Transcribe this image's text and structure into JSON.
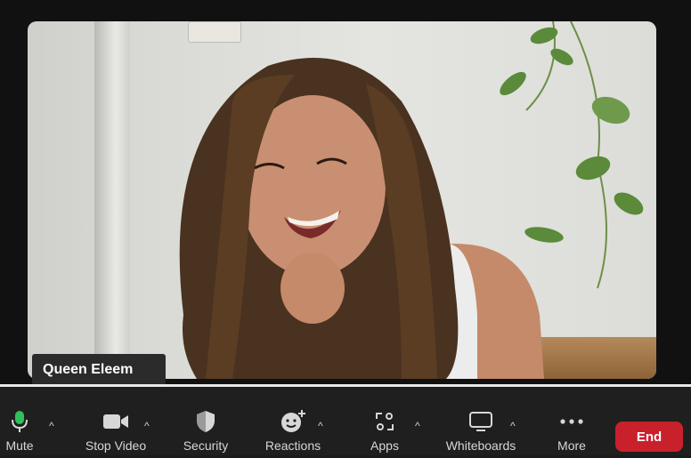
{
  "participant": {
    "name": "Queen Eleem"
  },
  "toolbar": {
    "mute_label": "Mute",
    "stop_video_label": "Stop Video",
    "security_label": "Security",
    "reactions_label": "Reactions",
    "apps_label": "Apps",
    "whiteboards_label": "Whiteboards",
    "more_label": "More",
    "end_label": "End",
    "caret_glyph": "^"
  },
  "colors": {
    "end": "#c8212b",
    "toolbar_bg": "#1f1f1f",
    "mic_active": "#2fbf5b"
  },
  "icons": [
    "microphone-icon",
    "video-camera-icon",
    "shield-icon",
    "emoji-add-icon",
    "apps-icon",
    "whiteboard-icon",
    "more-dots-icon"
  ]
}
